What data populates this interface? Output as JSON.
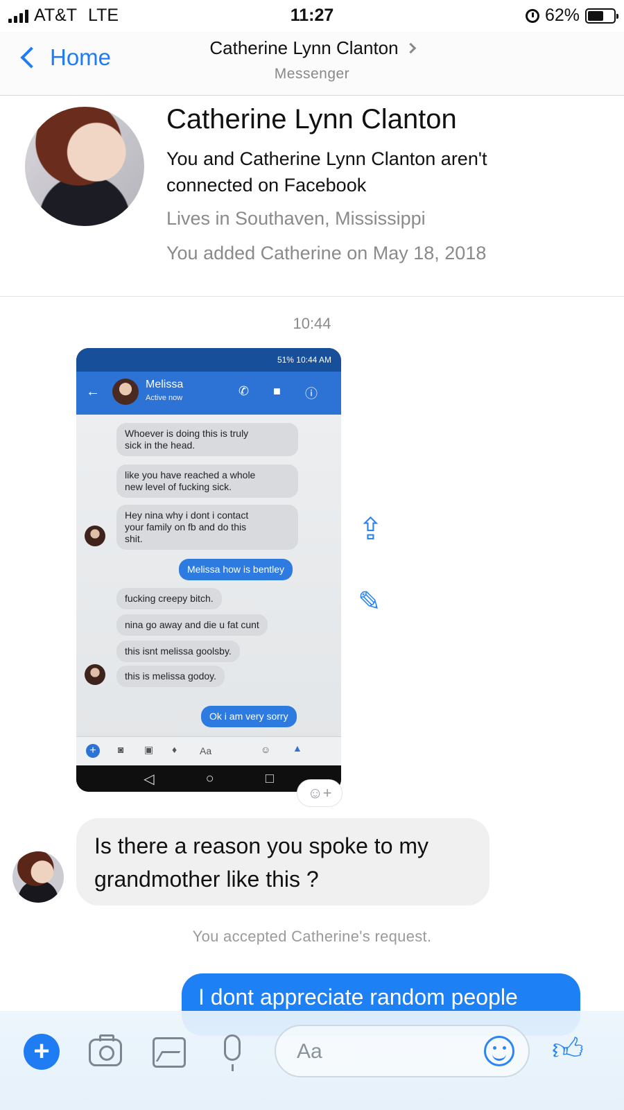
{
  "status_bar": {
    "carrier": "AT&T",
    "network": "LTE",
    "time": "11:27",
    "battery": "62%",
    "battery_level": 0.62
  },
  "nav": {
    "back_label": "Home",
    "title": "Catherine Lynn Clanton",
    "subtitle": "Messenger"
  },
  "profile": {
    "name": "Catherine Lynn Clanton",
    "connection_line1": "You and Catherine Lynn Clanton aren't",
    "connection_line2": "connected on Facebook",
    "lives": "Lives in Southaven, Mississippi",
    "added": "You added Catherine on May 18, 2018"
  },
  "conversation": {
    "timestamp": "10:44",
    "screenshot": {
      "status": "51%  10:44 AM",
      "contact_name": "Melissa",
      "contact_status": "Active now",
      "messages": [
        {
          "text_line1": "Whoever is doing this is truly",
          "text_line2": "sick in the head."
        },
        {
          "text_line1": "like you have reached a whole",
          "text_line2": "new level of fucking sick."
        },
        {
          "text_line1": "Hey nina why i dont i contact",
          "text_line2": "your family on fb and do this",
          "text_line3": "shit."
        },
        {
          "text": "Melissa how is bentley",
          "from_me": true
        },
        {
          "text": "fucking creepy bitch."
        },
        {
          "text": "nina go away and die u fat cunt"
        },
        {
          "text": "this isnt melissa goolsby."
        },
        {
          "text": "this is melissa godoy."
        },
        {
          "text": "Ok i am very sorry",
          "from_me": true
        }
      ],
      "composer_placeholder": "Aa"
    },
    "incoming_line1": "Is there a reason you spoke to my",
    "incoming_line2": "grandmother like this ?",
    "system_message": "You accepted Catherine's request.",
    "outgoing": "I dont appreciate random people"
  },
  "composer": {
    "placeholder": "Aa"
  },
  "colors": {
    "accent": "#1f7cf2",
    "outgoing_bubble": "#1e80f5",
    "incoming_bubble": "#f0f0f1"
  },
  "icons": [
    "signal-icon",
    "alarm-icon",
    "battery-icon",
    "back-chevron-icon",
    "share-icon",
    "edit-icon",
    "add-reaction-icon",
    "plus-icon",
    "camera-icon",
    "image-icon",
    "mic-icon",
    "emoji-icon",
    "like-icon"
  ]
}
